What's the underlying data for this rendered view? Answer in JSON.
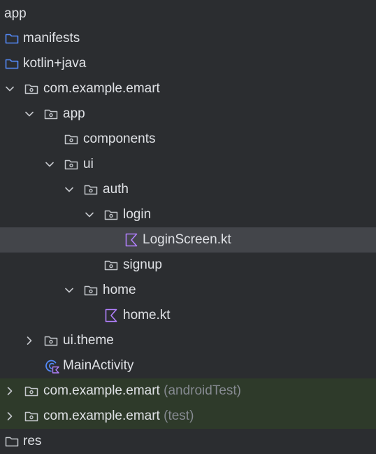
{
  "project": {
    "root_label": "app"
  },
  "tree": {
    "manifests": "manifests",
    "kotlin_java": "kotlin+java",
    "pkg_main": "com.example.emart",
    "app": "app",
    "components": "components",
    "ui": "ui",
    "auth": "auth",
    "login": "login",
    "login_screen": "LoginScreen.kt",
    "signup": "signup",
    "home": "home",
    "home_kt": "home.kt",
    "ui_theme": "ui.theme",
    "main_activity": "MainActivity",
    "pkg_android_test": "com.example.emart",
    "pkg_android_test_suffix": "(androidTest)",
    "pkg_test": "com.example.emart",
    "pkg_test_suffix": "(test)",
    "res": "res"
  },
  "colors": {
    "background": "#2b2d30",
    "selection": "#43454a",
    "test_source_bg": "#2e3a2a",
    "folder_blue": "#548af7",
    "kotlin_purple": "#b07ffa",
    "text": "#dfe1e5",
    "muted_text": "#868a91"
  },
  "icons": {
    "source_folder": "folder-icon",
    "package": "package-icon",
    "kotlin_file": "kotlin-file-icon",
    "activity": "activity-icon",
    "expanded": "chevron-down-icon",
    "collapsed": "chevron-right-icon"
  }
}
